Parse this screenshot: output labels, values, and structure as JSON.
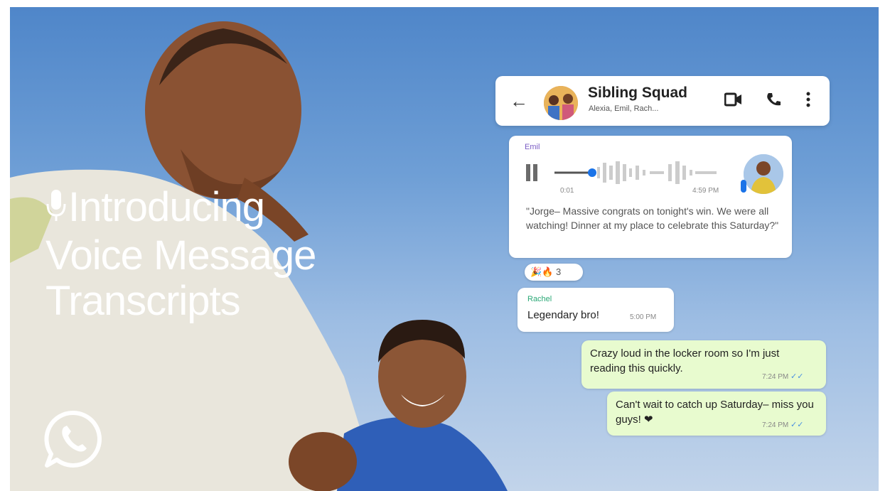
{
  "headline": {
    "line1": "Introducing",
    "line2": "Voice Message",
    "line3": "Transcripts"
  },
  "icons": {
    "mic": "microphone-icon",
    "logo": "whatsapp-logo",
    "back": "back-arrow-icon",
    "video": "video-call-icon",
    "call": "phone-call-icon",
    "menu": "more-vert-icon"
  },
  "chat": {
    "header": {
      "back_glyph": "←",
      "title": "Sibling Squad",
      "subtitle": "Alexia, Emil, Rach..."
    },
    "voice_message": {
      "sender": "Emil",
      "duration": "0:01",
      "time": "4:59 PM",
      "transcript": "\"Jorge– Massive congrats on tonight's win. We were all watching! Dinner at my place to celebrate this Saturday?\"",
      "reactions": "🎉🔥 3"
    },
    "reply": {
      "sender": "Rachel",
      "text": "Legendary bro!",
      "time": "5:00 PM"
    },
    "outgoing": [
      {
        "text": "Crazy loud in the locker room so I'm just reading this quickly.",
        "time": "7:24 PM"
      },
      {
        "text": "Can't wait to catch up Saturday– miss you guys! ❤",
        "time": "7:24 PM"
      }
    ]
  },
  "colors": {
    "sky_top": "#4f86c9",
    "sky_bottom": "#c2d4ea",
    "outgoing_bubble": "#e8fbcf",
    "sender_emil": "#7a5cc4",
    "sender_rachel": "#2aa876",
    "accent_blue": "#1a73e8"
  }
}
